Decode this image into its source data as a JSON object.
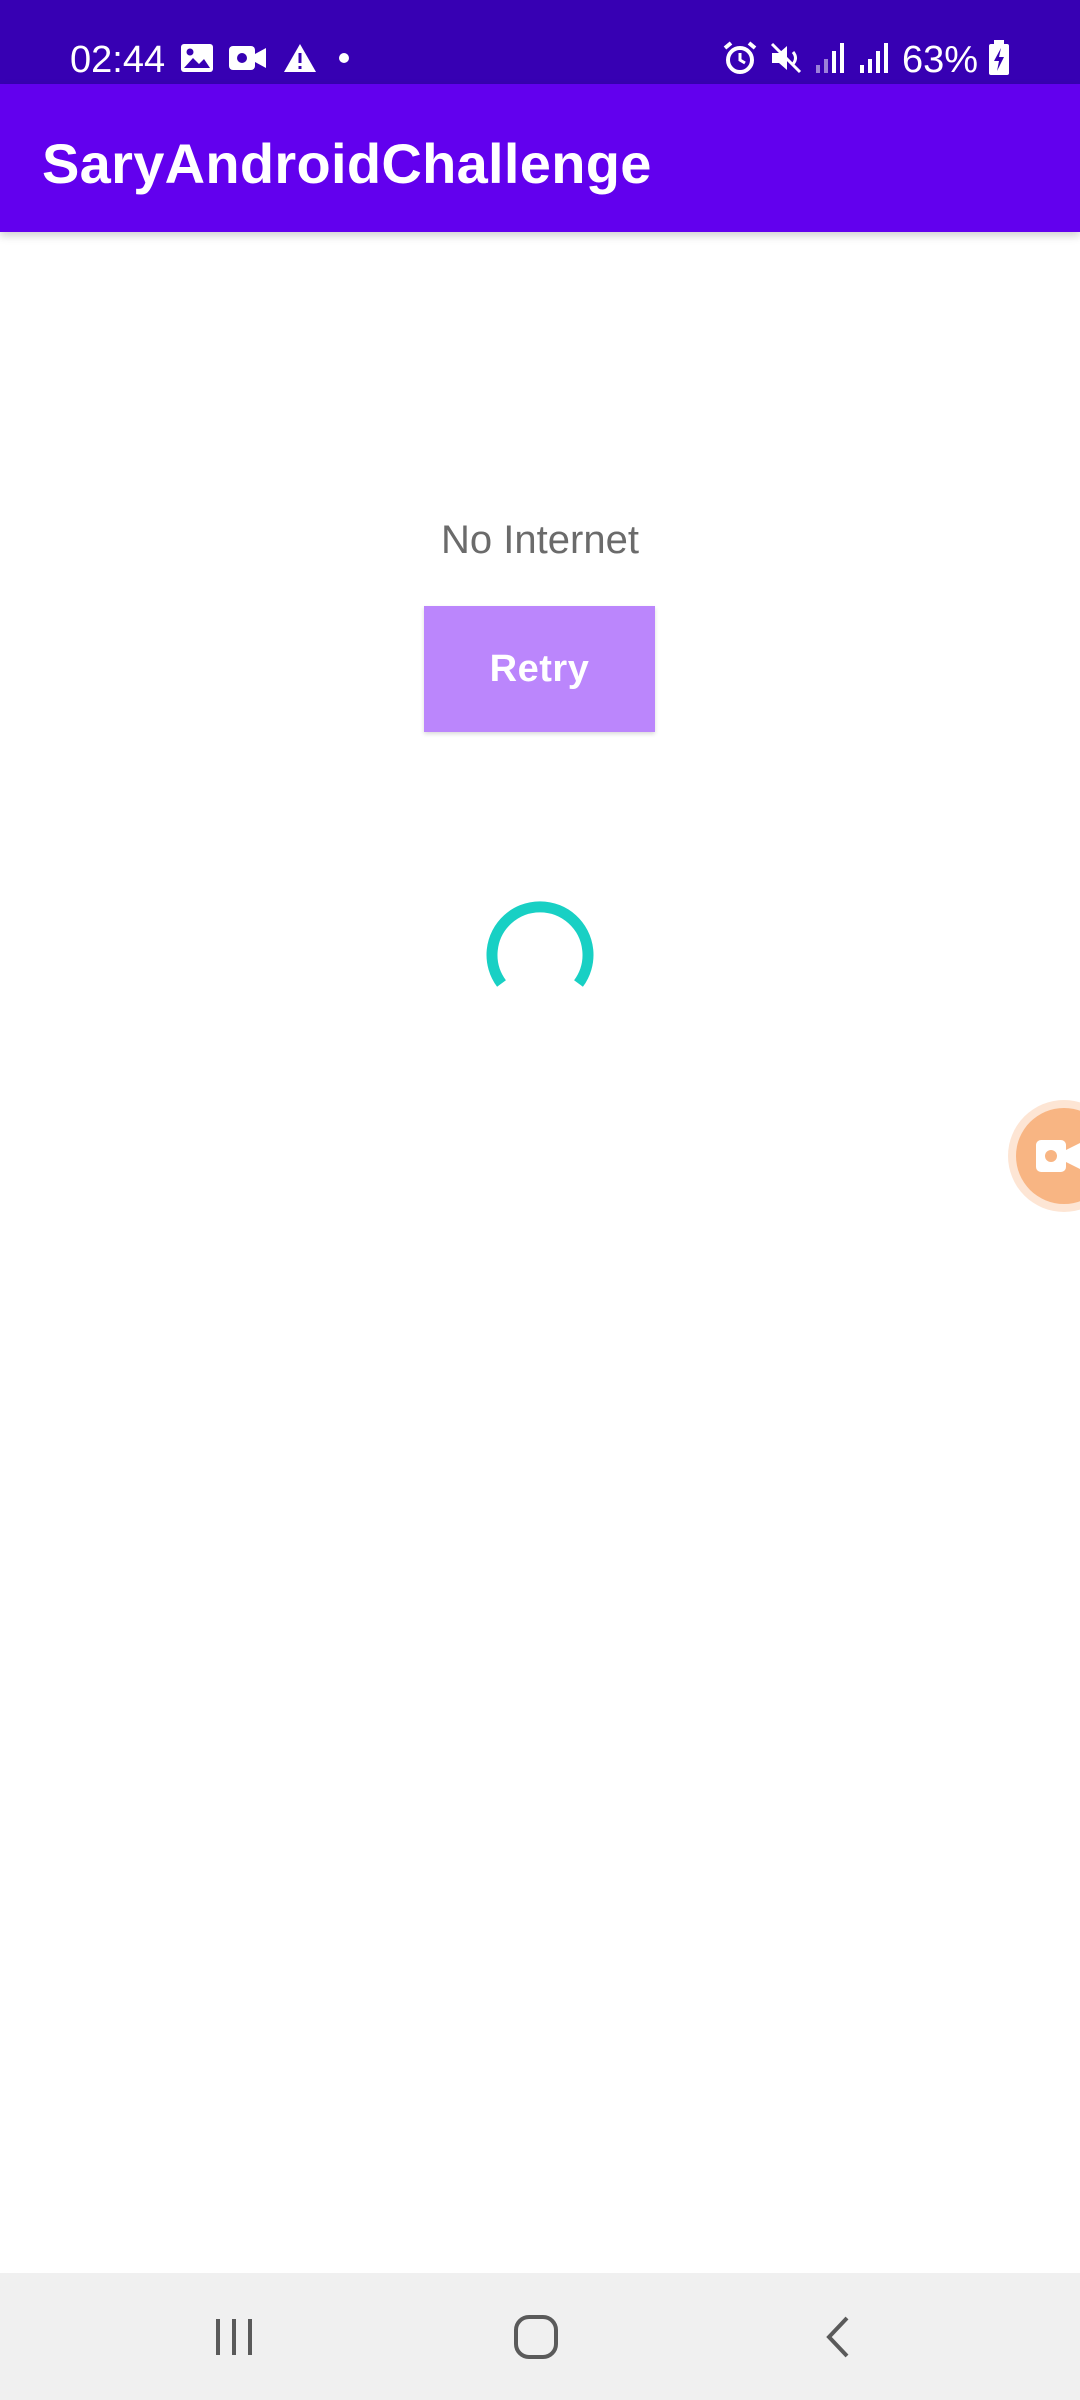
{
  "status_bar": {
    "time": "02:44",
    "battery_percent": "63%",
    "left_icons": [
      "gallery-icon",
      "video-camera-icon",
      "warning-icon",
      "dot-icon"
    ],
    "right_icons": [
      "alarm-icon",
      "mute-icon",
      "signal-icon",
      "signal-icon",
      "battery-charging-icon"
    ]
  },
  "app_bar": {
    "title": "SaryAndroidChallenge"
  },
  "content": {
    "message": "No Internet",
    "retry_label": "Retry",
    "spinner_icon": "loading-spinner-icon"
  },
  "floating": {
    "recorder_icon": "screen-recorder-icon"
  },
  "nav_bar": {
    "buttons": [
      "recents-icon",
      "home-icon",
      "back-icon"
    ]
  },
  "colors": {
    "status_bar": "#3700B3",
    "app_bar": "#6200EE",
    "button": "#BB86FC",
    "spinner": "#18D0C4",
    "recorder": "#F8B583"
  }
}
